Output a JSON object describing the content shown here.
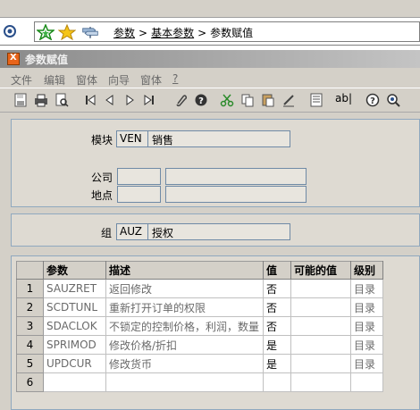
{
  "nav": {
    "crumbs": [
      "参数",
      "基本参数",
      "参数赋值"
    ],
    "separator": ">"
  },
  "window": {
    "title": "参数赋值",
    "logo_text": "X"
  },
  "menu": [
    {
      "label": "文件"
    },
    {
      "label": "编辑"
    },
    {
      "label": "窗体"
    },
    {
      "label": "向导"
    },
    {
      "label": "窗体"
    },
    {
      "label": "?"
    }
  ],
  "toolbar": {
    "text_button": "ab|",
    "icons": [
      "save-icon",
      "print-icon",
      "print-preview-icon",
      "first-record-icon",
      "previous-record-icon",
      "next-record-icon",
      "last-record-icon",
      "attach-icon",
      "help-icon",
      "cut-icon",
      "copy-icon",
      "paste-icon",
      "edit-icon",
      "list-icon",
      "text-icon",
      "question-icon",
      "zoom-icon"
    ]
  },
  "module": {
    "label": "模块",
    "code": "VEN",
    "name": "销售"
  },
  "company": {
    "label": "公司",
    "code": "",
    "name": ""
  },
  "site": {
    "label": "地点",
    "code": "",
    "name": ""
  },
  "group": {
    "label": "组",
    "code": "AUZ",
    "name": "授权"
  },
  "grid": {
    "columns": [
      "参数",
      "描述",
      "值",
      "可能的值",
      "级别"
    ],
    "rows": [
      {
        "n": "1",
        "param": "SAUZRET",
        "desc": "返回修改",
        "value": "否",
        "possible": "",
        "level": "目录"
      },
      {
        "n": "2",
        "param": "SCDTUNL",
        "desc": "重新打开订单的权限",
        "value": "否",
        "possible": "",
        "level": "目录"
      },
      {
        "n": "3",
        "param": "SDACLOK",
        "desc": "不锁定的控制价格，利润，数量",
        "value": "否",
        "possible": "",
        "level": "目录"
      },
      {
        "n": "4",
        "param": "SPRIMOD",
        "desc": "修改价格/折扣",
        "value": "是",
        "possible": "",
        "level": "目录"
      },
      {
        "n": "5",
        "param": "UPDCUR",
        "desc": "修改货币",
        "value": "是",
        "possible": "",
        "level": "目录"
      },
      {
        "n": "6",
        "param": "",
        "desc": "",
        "value": "",
        "possible": "",
        "level": ""
      }
    ]
  }
}
